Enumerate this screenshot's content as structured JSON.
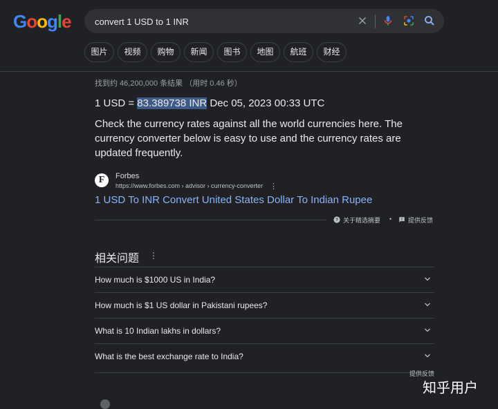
{
  "logo": {
    "text": "Google",
    "letters": [
      "G",
      "o",
      "o",
      "g",
      "l",
      "e"
    ],
    "colors": [
      "#4285f4",
      "#ea4335",
      "#fbbc05",
      "#4285f4",
      "#34a853",
      "#ea4335"
    ]
  },
  "search": {
    "query": "convert 1 USD to 1 INR",
    "placeholder": ""
  },
  "search_icons": [
    "clear-icon",
    "microphone-icon",
    "lens-icon",
    "search-icon"
  ],
  "tabs": [
    {
      "label": "图片"
    },
    {
      "label": "视频"
    },
    {
      "label": "购物"
    },
    {
      "label": "新闻"
    },
    {
      "label": "图书"
    },
    {
      "label": "地图"
    },
    {
      "label": "航班"
    },
    {
      "label": "财经"
    }
  ],
  "result_stats": "找到约 46,200,000 条结果 （用时 0.46 秒）",
  "answer": {
    "prefix": "1 USD = ",
    "highlight": "83.389738 INR",
    "suffix": " Dec 05, 2023 00:33 UTC",
    "description": "Check the currency rates against all the world currencies here. The currency converter below is easy to use and the currency rates are updated frequently."
  },
  "source": {
    "logo_letter": "F",
    "name": "Forbes",
    "url": "https://www.forbes.com › advisor › currency-converter",
    "link_title": "1 USD To INR Convert United States Dollar To Indian Rupee"
  },
  "snippet_footer": {
    "about": "关于精选摘要",
    "separator": "•",
    "feedback": "提供反馈"
  },
  "paa": {
    "title": "相关问题",
    "questions": [
      "How much is $1000 US in India?",
      "How much is $1 US dollar in Pakistani rupees?",
      "What is 10 Indian lakhs in dollars?",
      "What is the best exchange rate to India?"
    ],
    "feedback": "提供反馈"
  },
  "watermark": "知乎用户",
  "colors": {
    "background": "#202124",
    "surface": "#303134",
    "link": "#8ab4f8",
    "highlight": "#3e5a86"
  }
}
